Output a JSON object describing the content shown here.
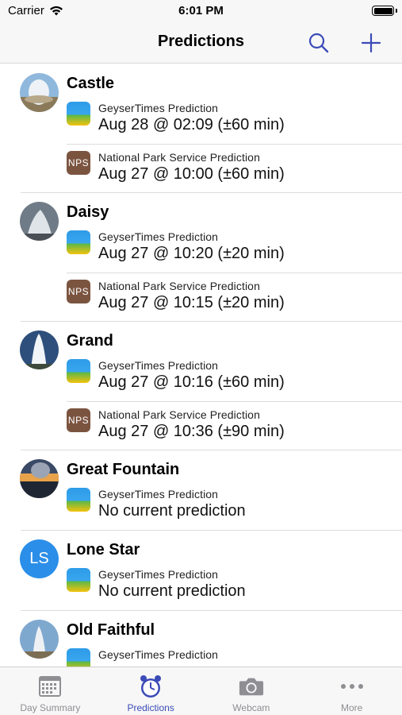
{
  "status_bar": {
    "carrier": "Carrier",
    "time": "6:01 PM"
  },
  "nav": {
    "title": "Predictions"
  },
  "colors": {
    "accent": "#3b4bb8",
    "inactive": "#8e8e93",
    "nps_brown": "#7b5440",
    "lonestar_blue": "#2b8ee8"
  },
  "geysers": [
    {
      "name": "Castle",
      "predictions": [
        {
          "source": "GeyserTimes Prediction",
          "value": "Aug 28 @ 02:09 (±60 min)",
          "icon": "geysertimes-icon"
        },
        {
          "source": "National Park Service Prediction",
          "value": "Aug 27 @ 10:00 (±60 min)",
          "icon": "nps-icon",
          "badge": "NPS"
        }
      ]
    },
    {
      "name": "Daisy",
      "predictions": [
        {
          "source": "GeyserTimes Prediction",
          "value": "Aug 27 @ 10:20 (±20 min)",
          "icon": "geysertimes-icon"
        },
        {
          "source": "National Park Service Prediction",
          "value": "Aug 27 @ 10:15 (±20 min)",
          "icon": "nps-icon",
          "badge": "NPS"
        }
      ]
    },
    {
      "name": "Grand",
      "predictions": [
        {
          "source": "GeyserTimes Prediction",
          "value": "Aug 27 @ 10:16 (±60 min)",
          "icon": "geysertimes-icon"
        },
        {
          "source": "National Park Service Prediction",
          "value": "Aug 27 @ 10:36 (±90 min)",
          "icon": "nps-icon",
          "badge": "NPS"
        }
      ]
    },
    {
      "name": "Great Fountain",
      "predictions": [
        {
          "source": "GeyserTimes Prediction",
          "value": "No current prediction",
          "icon": "geysertimes-icon"
        }
      ]
    },
    {
      "name": "Lone Star",
      "avatar_initials": "LS",
      "predictions": [
        {
          "source": "GeyserTimes Prediction",
          "value": "No current prediction",
          "icon": "geysertimes-icon"
        }
      ]
    },
    {
      "name": "Old Faithful",
      "predictions": [
        {
          "source": "GeyserTimes Prediction",
          "value": "",
          "icon": "geysertimes-icon"
        }
      ]
    }
  ],
  "tabs": [
    {
      "label": "Day Summary",
      "icon": "calendar-icon",
      "active": false
    },
    {
      "label": "Predictions",
      "icon": "alarm-clock-icon",
      "active": true
    },
    {
      "label": "Webcam",
      "icon": "camera-icon",
      "active": false
    },
    {
      "label": "More",
      "icon": "more-icon",
      "active": false
    }
  ]
}
